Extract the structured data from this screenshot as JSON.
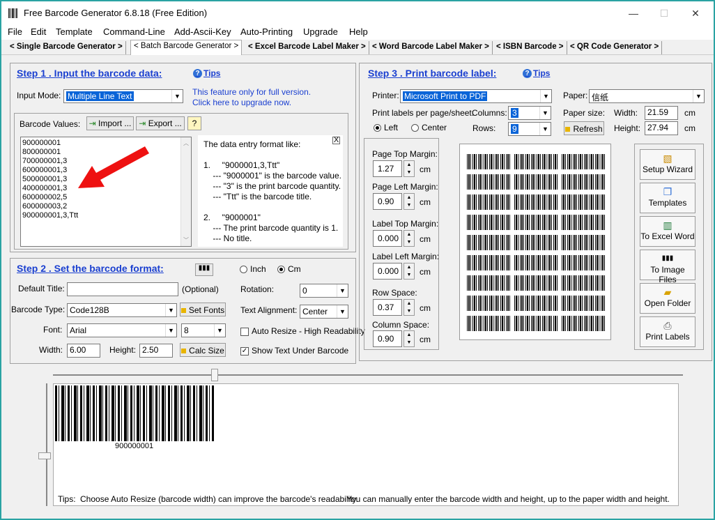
{
  "window": {
    "title": "Free Barcode Generator  6.8.18  (Free Edition)",
    "minimize": "—",
    "maximize": "☐",
    "close": "✕"
  },
  "menu": [
    "File",
    "Edit",
    "Template",
    "Command-Line",
    "Add-Ascii-Key",
    "Auto-Printing",
    "Upgrade",
    "Help"
  ],
  "tabs": [
    "< Single Barcode Generator >",
    "< Batch Barcode Generator >",
    "< Excel Barcode Label Maker >",
    "< Word Barcode Label Maker >",
    "< ISBN Barcode >",
    "< QR Code Generator >"
  ],
  "step1": {
    "title": "Step 1 .  Input the barcode data:",
    "tips": "Tips",
    "input_mode_label": "Input Mode:",
    "input_mode_value": "Multiple Line Text",
    "notice_line1": "This feature only for full version.",
    "notice_line2": "Click here to upgrade now.",
    "barcode_values_label": "Barcode Values:",
    "import_btn": "Import ...",
    "export_btn": "Export ...",
    "help_btn": "?",
    "values": [
      "900000001",
      "800000001",
      "700000001,3",
      "600000001,3",
      "500000001,3",
      "400000001,3",
      "600000002,5",
      "600000003,2",
      "900000001,3,Ttt"
    ],
    "help_close": "X",
    "help_lines": [
      "The data entry format like:",
      "",
      "1.     \"9000001,3,Ttt\"",
      "    --- \"9000001\" is the barcode value.",
      "    --- \"3\" is the print barcode quantity.",
      "    --- \"Ttt\" is the barcode title.",
      "",
      "2.     \"9000001\"",
      "    --- The print barcode quantity is 1.",
      "    --- No title."
    ]
  },
  "step2": {
    "title": "Step 2 . Set the barcode format:",
    "inch": "Inch",
    "cm": "Cm",
    "default_title_label": "Default Title:",
    "default_title_value": "",
    "optional": "(Optional)",
    "rotation_label": "Rotation:",
    "rotation_value": "0",
    "barcode_type_label": "Barcode Type:",
    "barcode_type_value": "Code128B",
    "set_fonts": "Set Fonts",
    "text_align_label": "Text Alignment:",
    "text_align_value": "Center",
    "font_label": "Font:",
    "font_value": "Arial",
    "font_size_value": "8",
    "auto_resize": "Auto Resize - High Readability",
    "width_label": "Width:",
    "width_value": "6.00",
    "height_label": "Height:",
    "height_value": "2.50",
    "calc_size": "Calc Size",
    "show_text": "Show Text Under Barcode"
  },
  "step3": {
    "title": "Step 3 . Print barcode label:",
    "tips": "Tips",
    "printer_label": "Printer:",
    "printer_value": "Microsoft Print to PDF",
    "paper_label": "Paper:",
    "paper_value": "信纸",
    "per_sheet_label": "Print labels per page/sheet:",
    "columns_label": "Columns:",
    "columns_value": "3",
    "paper_size_label": "Paper size:",
    "width_label": "Width:",
    "width_value": "21.59",
    "cm1": "cm",
    "left": "Left",
    "center": "Center",
    "rows_label": "Rows:",
    "rows_value": "9",
    "refresh": "Refresh",
    "height_label": "Height:",
    "height_value": "27.94",
    "cm2": "cm",
    "margins": [
      {
        "label": "Page Top Margin:",
        "value": "1.27",
        "unit": "cm"
      },
      {
        "label": "Page Left Margin:",
        "value": "0.90",
        "unit": "cm"
      },
      {
        "label": "Label Top Margin:",
        "value": "0.000",
        "unit": "cm"
      },
      {
        "label": "Label Left Margin:",
        "value": "0.000",
        "unit": "cm"
      },
      {
        "label": "Row Space:",
        "value": "0.37",
        "unit": "cm"
      },
      {
        "label": "Column Space:",
        "value": "0.90",
        "unit": "cm"
      }
    ],
    "actions": [
      "Setup Wizard",
      "Templates",
      "To Excel Word",
      "To Image Files",
      "Open Folder",
      "Print Labels"
    ]
  },
  "preview": {
    "barcode_text": "900000001",
    "tips_label": "Tips:",
    "tip1": "Choose Auto Resize (barcode width)  can improve the barcode's readability.",
    "tip2": "You can manually enter the barcode width and height, up to the paper width and height."
  }
}
